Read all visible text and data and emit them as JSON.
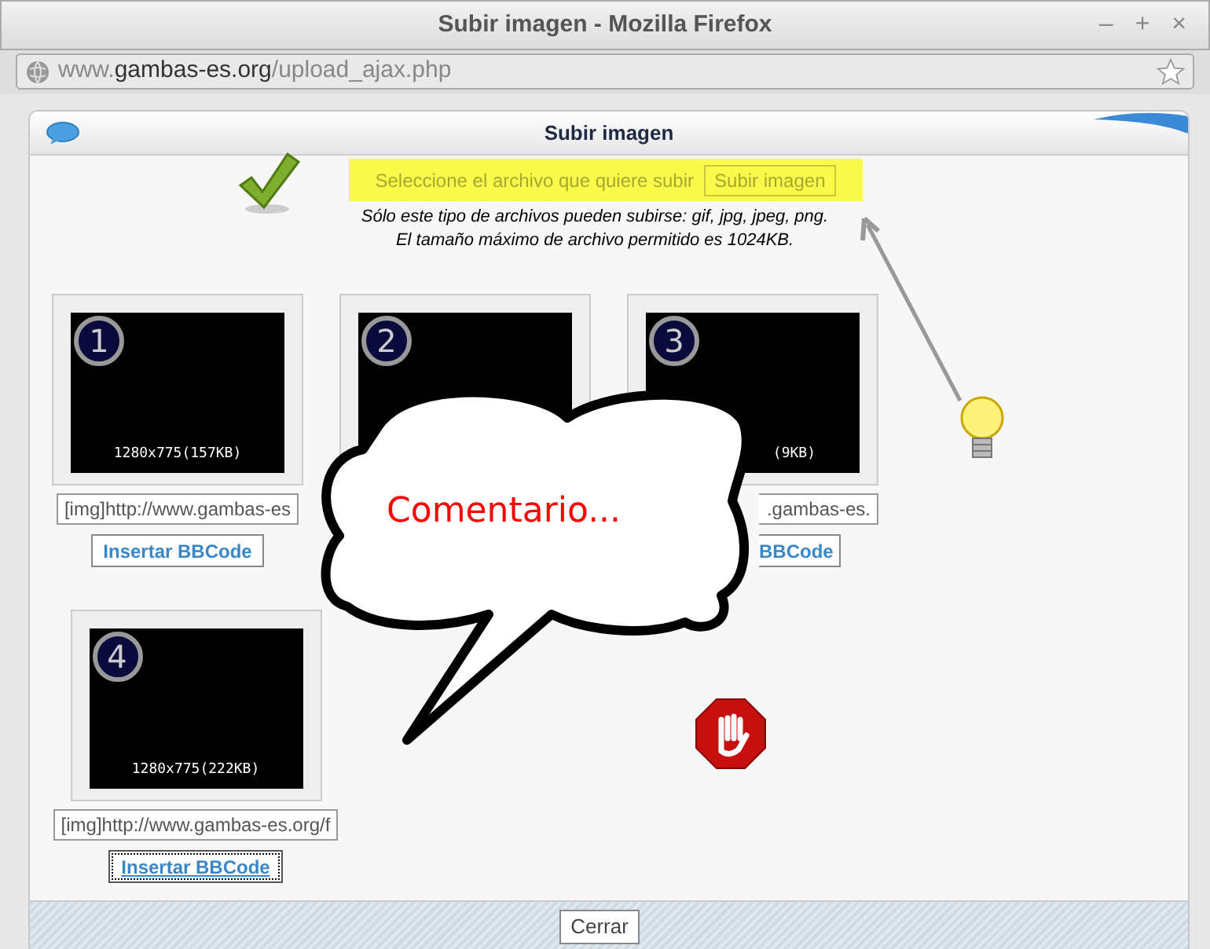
{
  "window": {
    "title": "Subir imagen - Mozilla Firefox",
    "controls": [
      "–",
      "+",
      "×"
    ]
  },
  "address_bar": {
    "prefix": "www.",
    "domain": "gambas-es.org",
    "path": "/upload_ajax.php"
  },
  "dialog": {
    "title": "Subir imagen",
    "upload": {
      "label": "Seleccione el archivo que quiere subir",
      "button": "Subir imagen",
      "disabled": true,
      "highlighted": true
    },
    "notes": [
      "Sólo este tipo de archivos pueden subirse: gif, jpg, jpeg, png.",
      "El tamaño máximo de archivo permitido es 1024KB."
    ],
    "images": [
      {
        "number": "1",
        "caption": "1280x775(157KB)",
        "code": "[img]http://www.gambas-es",
        "button": "Insertar BBCode",
        "focused": false,
        "cut_left": false
      },
      {
        "number": "2"
      },
      {
        "number": "3",
        "caption": "(9KB)",
        "code": ".gambas-es.",
        "button": "BBCode",
        "focused": false,
        "cut_left": true
      },
      {
        "number": "4",
        "caption": "1280x775(222KB)",
        "code": "[img]http://www.gambas-es.org/f",
        "button": "Insertar BBCode",
        "focused": true,
        "cut_left": false
      }
    ],
    "close_button": "Cerrar"
  },
  "annotation": {
    "comment": "Comentario..."
  }
}
